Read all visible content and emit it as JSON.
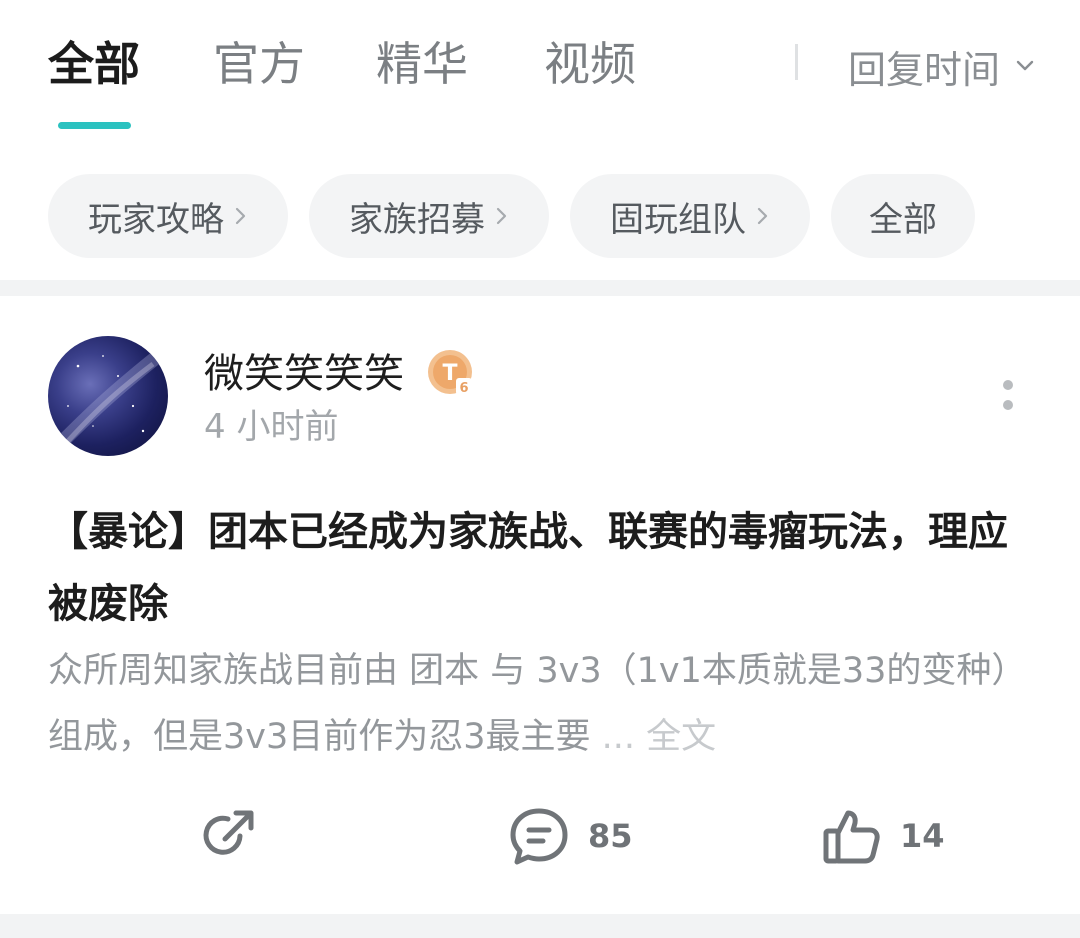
{
  "tabs": [
    {
      "label": "全部",
      "active": true
    },
    {
      "label": "官方",
      "active": false
    },
    {
      "label": "精华",
      "active": false
    },
    {
      "label": "视频",
      "active": false
    }
  ],
  "sort": {
    "label": "回复时间",
    "icon": "chevron-down-icon"
  },
  "chips": [
    {
      "label": "玩家攻略",
      "has_arrow": true
    },
    {
      "label": "家族招募",
      "has_arrow": true
    },
    {
      "label": "固玩组队",
      "has_arrow": true
    },
    {
      "label": "全部",
      "has_arrow": false
    }
  ],
  "post": {
    "author": "微笑笑笑笑",
    "badge": {
      "letter": "T",
      "level": "6"
    },
    "time": "4 小时前",
    "title": "【暴论】团本已经成为家族战、联赛的毒瘤玩法，理应被废除",
    "excerpt": "众所周知家族战目前由 团本 与 3v3（1v1本质就是33的变种）组成，但是3v3目前作为忍3最主要",
    "more_link": "... 全文",
    "share_icon": "share-icon",
    "comment_count": "85",
    "like_count": "14"
  },
  "colors": {
    "accent": "#2bc2c0",
    "badge": "#f0b27a"
  }
}
